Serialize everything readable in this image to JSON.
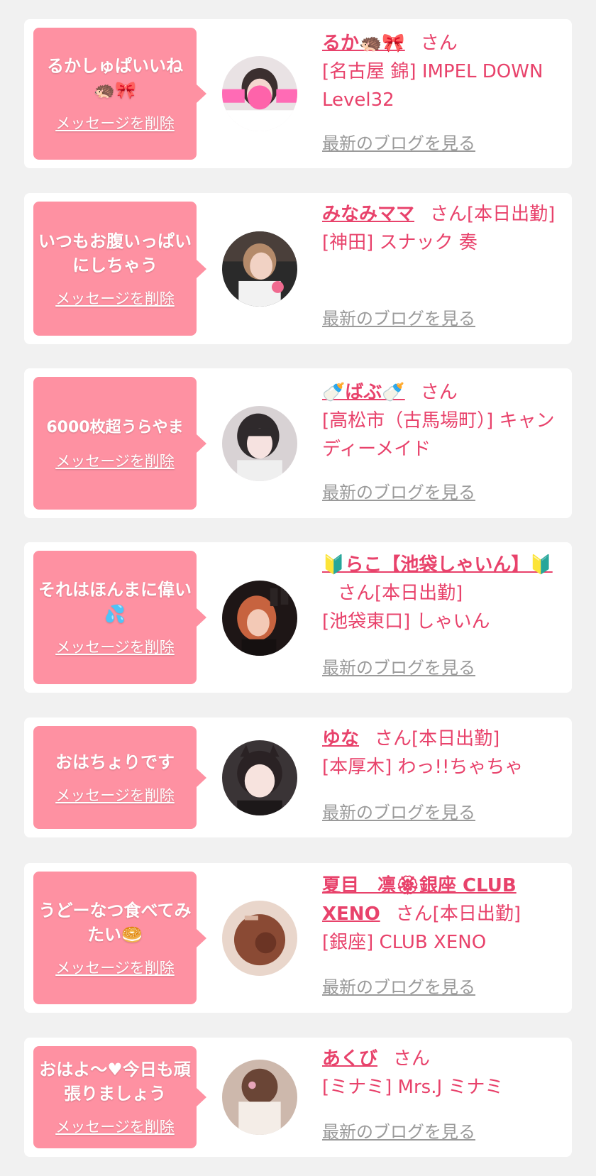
{
  "delete_label": "メッセージを削除",
  "blog_label": "最新のブログを見る",
  "colors": {
    "background": "#f1f1f1",
    "bubble": "#fe91a2",
    "accent": "#e8426b",
    "muted": "#9a9a9a"
  },
  "messages": [
    {
      "text": "るかしゅぱいいね🦔🎀",
      "name": "るか🦔🎀",
      "san": "さん",
      "shop": "[名古屋 錦] IMPEL DOWN Level32",
      "avatar": "avatar-photo"
    },
    {
      "text": "いつもお腹いっぱいにしちゃう",
      "name": "みなみママ",
      "san": "さん[本日出勤]",
      "shop": "[神田] スナック 奏",
      "avatar": "avatar-photo"
    },
    {
      "text": "6000枚超うらやま",
      "name": "🍼ばぶ🍼",
      "san": "さん",
      "shop": "[高松市（古馬場町）] キャンディーメイド",
      "avatar": "avatar-photo"
    },
    {
      "text": "それはほんまに偉い💦",
      "name": "🔰らこ【池袋しゃいん】🔰",
      "san": "さん[本日出勤]",
      "shop": "[池袋東口] しゃいん",
      "avatar": "avatar-photo"
    },
    {
      "text": "おはちょりです",
      "name": "ゆな",
      "san": "さん[本日出勤]",
      "shop": "[本厚木] わっ!!ちゃちゃ",
      "avatar": "avatar-photo"
    },
    {
      "text": "うどーなつ食べてみたい🥯",
      "name": "夏目　凛🏵銀座 CLUB XENO",
      "san": "さん[本日出勤]",
      "shop": "[銀座] CLUB XENO",
      "avatar": "avatar-photo"
    },
    {
      "text": "おはよ〜♥今日も頑張りましょう",
      "name": "あくび",
      "san": "さん",
      "shop": "[ミナミ] Mrs.J ミナミ",
      "avatar": "avatar-photo"
    }
  ]
}
